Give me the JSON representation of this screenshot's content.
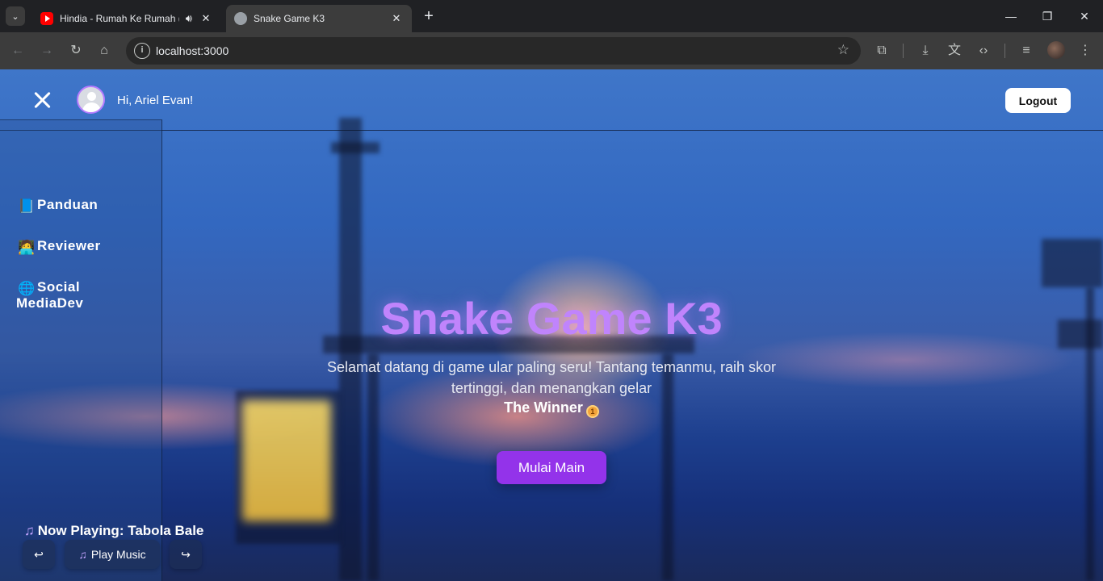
{
  "browser": {
    "tabs": [
      {
        "title": "Hindia - Rumah Ke Rumah (",
        "favicon": "youtube-icon",
        "audio": true
      },
      {
        "title": "Snake Game K3",
        "favicon": "globe-icon",
        "active": true
      }
    ],
    "url": "localhost:3000"
  },
  "header": {
    "greeting": "Hi, Ariel Evan!",
    "logout_label": "Logout"
  },
  "sidebar": {
    "items": [
      {
        "emoji": "📘",
        "label": "Panduan"
      },
      {
        "emoji": "🧑‍💻",
        "label": "Reviewer"
      },
      {
        "emoji": "🌐",
        "label": "Social",
        "label2": "MediaDev"
      }
    ]
  },
  "music": {
    "now_playing_prefix": "Now Playing: ",
    "track": "Tabola Bale",
    "prev_label": "↩",
    "play_label": "Play Music",
    "next_label": "↪"
  },
  "hero": {
    "title": "Snake Game K3",
    "subtitle_line1": "Selamat datang di game ular paling seru! Tantang temanmu, raih skor",
    "subtitle_line2": "tertinggi, dan menangkan gelar",
    "winner": "The Winner",
    "button_label": "Mulai Main"
  },
  "colors": {
    "accent": "#c084fc",
    "button": "#9333ea"
  }
}
